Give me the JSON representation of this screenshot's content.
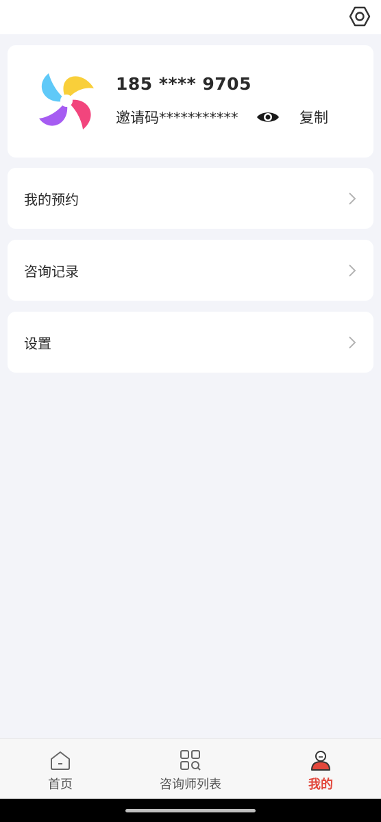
{
  "header": {
    "settings_icon": "settings-hexagon-icon"
  },
  "profile": {
    "phone": "185 **** 9705",
    "invite_text": "邀请码***********",
    "eye_icon": "eye-icon",
    "copy_label": "复制"
  },
  "menu": [
    {
      "label": "我的预约",
      "icon": "chevron-right-icon"
    },
    {
      "label": "咨询记录",
      "icon": "chevron-right-icon"
    },
    {
      "label": "设置",
      "icon": "chevron-right-icon"
    }
  ],
  "tabbar": [
    {
      "label": "首页",
      "icon": "home-icon",
      "active": false
    },
    {
      "label": "咨询师列表",
      "icon": "grid-search-icon",
      "active": false
    },
    {
      "label": "我的",
      "icon": "user-icon",
      "active": true
    }
  ],
  "colors": {
    "accent": "#e2473c",
    "background": "#f3f4f9",
    "card": "#ffffff"
  }
}
